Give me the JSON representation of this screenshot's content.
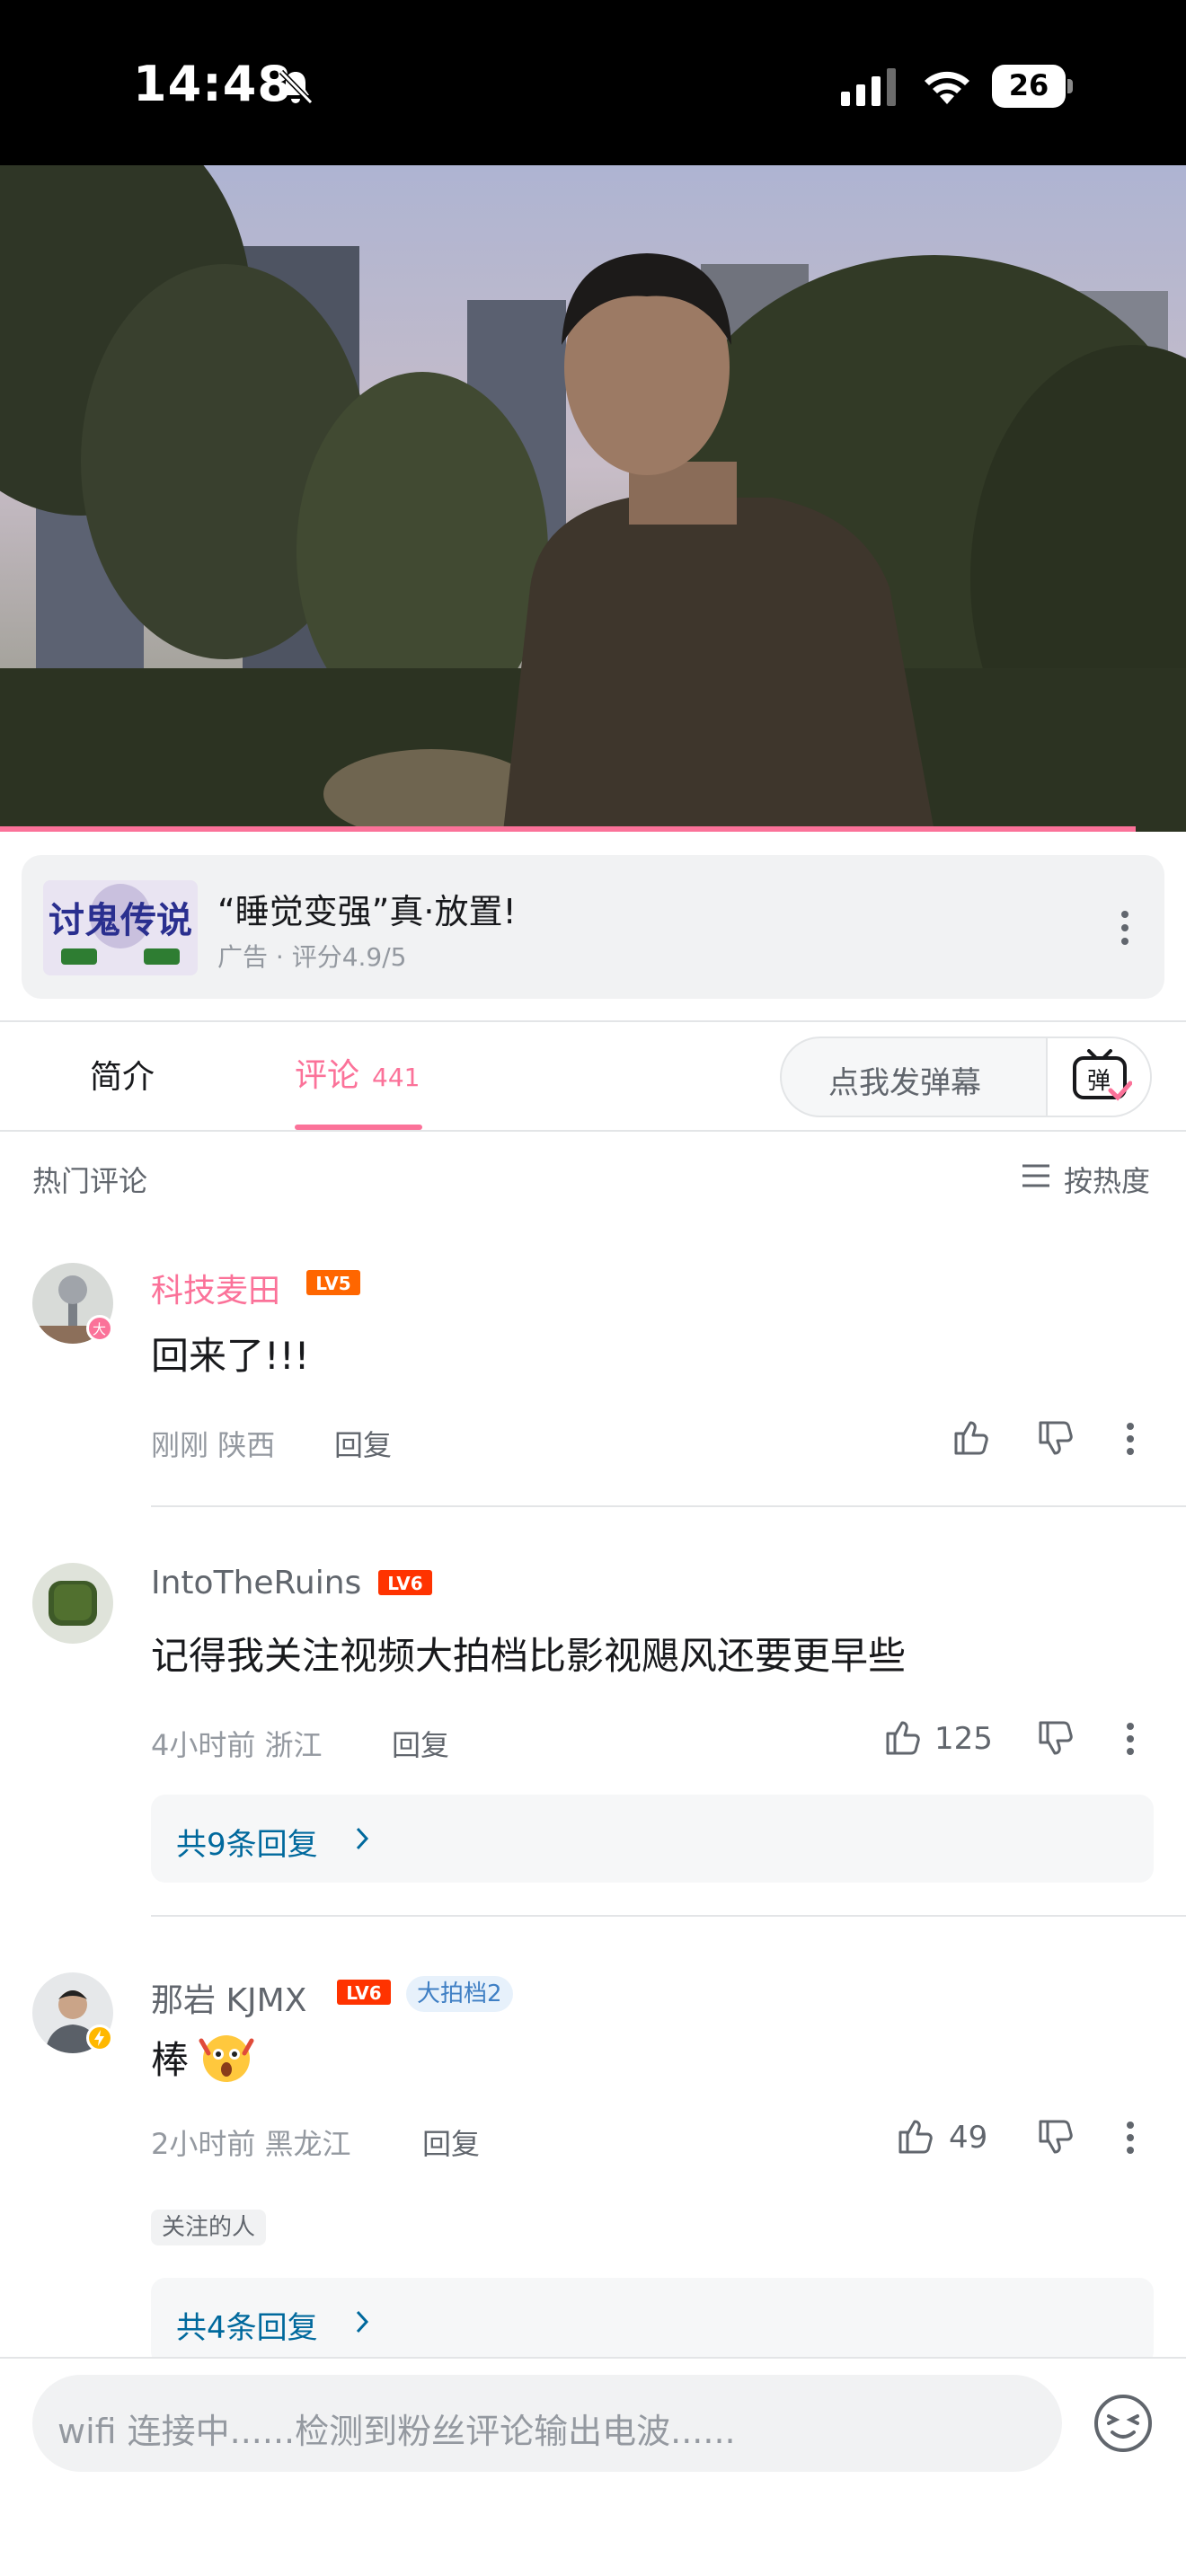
{
  "status_bar": {
    "time": "14:48",
    "battery": "26"
  },
  "ad": {
    "title": "“睡觉变强”真·放置!",
    "subtitle": "广告 · 评分4.9/5",
    "logo_text": "讨鬼传说"
  },
  "tabs": {
    "intro": "简介",
    "comments": "评论",
    "comments_count": "441",
    "danmaku_placeholder": "点我发弹幕",
    "danmaku_icon_text": "弹"
  },
  "hot": {
    "title": "热门评论",
    "sort_label": "按热度"
  },
  "comments": [
    {
      "user": "科技麦田",
      "level": "LV5",
      "text": "回来了!!!",
      "time": "刚刚",
      "location": "陕西",
      "reply": "回复",
      "likes": "",
      "avatar_badge_text": "大"
    },
    {
      "user": "IntoTheRuins",
      "level": "LV6",
      "text": "记得我关注视频大拍档比影视飓风还要更早些",
      "time": "4小时前",
      "location": "浙江",
      "reply": "回复",
      "likes": "125",
      "replies_label": "共9条回复"
    },
    {
      "user": "那岩 KJMX",
      "level": "LV6",
      "badge": "大拍档2",
      "text": "棒",
      "time": "2小时前",
      "location": "黑龙江",
      "reply": "回复",
      "likes": "49",
      "tag": "关注的人",
      "replies_label": "共4条回复"
    }
  ],
  "input": {
    "placeholder": "wifi 连接中......检测到粉丝评论输出电波......"
  },
  "colors": {
    "accent": "#fb7299",
    "link": "#00699d",
    "muted": "#9499a0",
    "lv5": "#ff6600",
    "lv6": "#ff3300"
  }
}
